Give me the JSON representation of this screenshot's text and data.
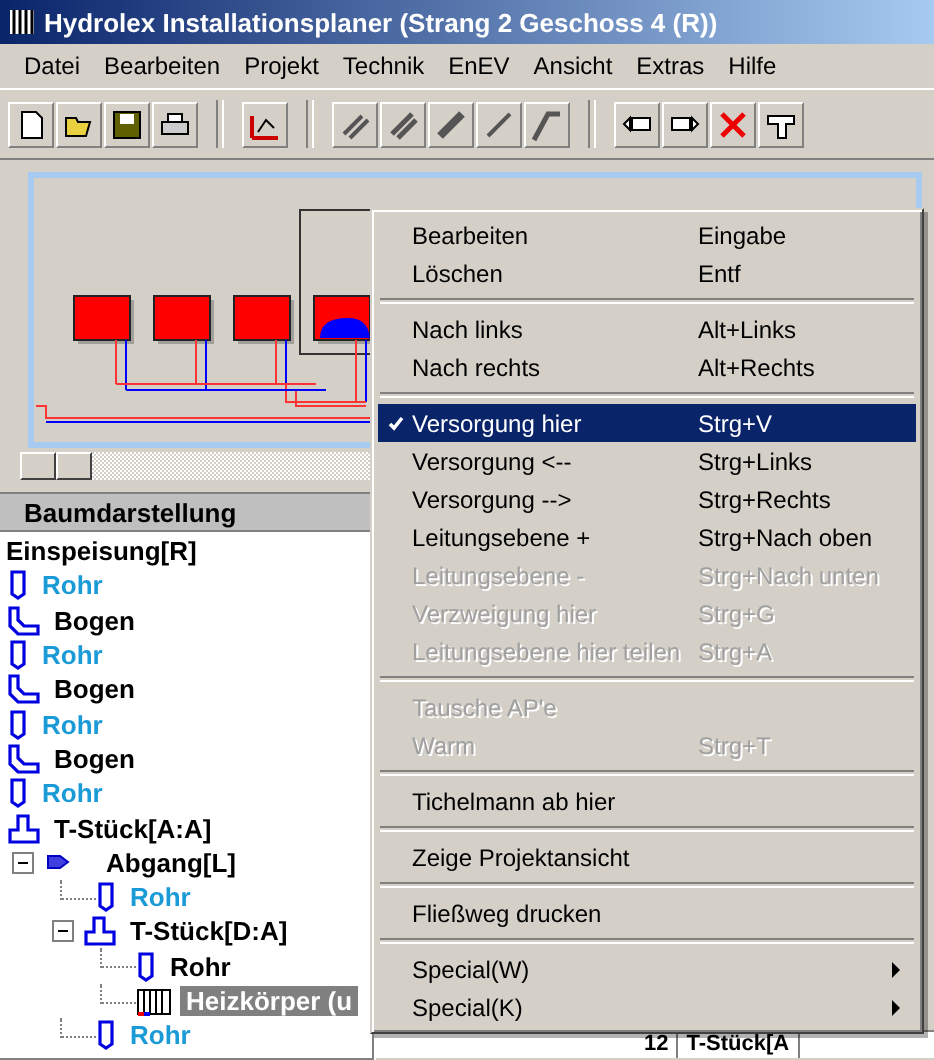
{
  "window": {
    "title": "Hydrolex Installationsplaner (Strang 2 Geschoss 4 (R))"
  },
  "menubar": [
    "Datei",
    "Bearbeiten",
    "Projekt",
    "Technik",
    "EnEV",
    "Ansicht",
    "Extras",
    "Hilfe"
  ],
  "tree_panel": {
    "title": "Baumdarstellung",
    "items": [
      {
        "label": "Einspeisung[R]",
        "kind": "feed",
        "color": "#000000",
        "selected": false
      },
      {
        "label": "Rohr",
        "kind": "pipe",
        "color": "#1a9ad6",
        "selected": false
      },
      {
        "label": "Bogen",
        "kind": "bend",
        "color": "#000000",
        "selected": false
      },
      {
        "label": "Rohr",
        "kind": "pipe",
        "color": "#1a9ad6",
        "selected": false
      },
      {
        "label": "Bogen",
        "kind": "bend",
        "color": "#000000",
        "selected": false
      },
      {
        "label": "Rohr",
        "kind": "pipe",
        "color": "#1a9ad6",
        "selected": false
      },
      {
        "label": "Bogen",
        "kind": "bend",
        "color": "#000000",
        "selected": false
      },
      {
        "label": "Rohr",
        "kind": "pipe",
        "color": "#1a9ad6",
        "selected": false
      },
      {
        "label": "T-Stück[A:A]",
        "kind": "tee",
        "color": "#000000",
        "selected": false,
        "children": [
          {
            "label": "Abgang[L]",
            "kind": "branch",
            "color": "#000000",
            "selected": false,
            "expanded": true,
            "children": [
              {
                "label": "Rohr",
                "kind": "pipe",
                "color": "#1a9ad6",
                "selected": false
              },
              {
                "label": "T-Stück[D:A]",
                "kind": "tee",
                "color": "#000000",
                "selected": false,
                "expanded": true,
                "children": [
                  {
                    "label": "Rohr",
                    "kind": "pipe",
                    "color": "#000000",
                    "selected": false
                  },
                  {
                    "label": "Heizkörper (u",
                    "kind": "radiator",
                    "selected": true
                  }
                ]
              },
              {
                "label": "Rohr",
                "kind": "pipe",
                "color": "#1a9ad6",
                "selected": false
              }
            ]
          }
        ]
      }
    ]
  },
  "detail_table": {
    "rows": [
      {
        "cells": [
          "12",
          "T-Stück[A"
        ]
      }
    ]
  },
  "context_menu": [
    {
      "kind": "item",
      "label": "Bearbeiten",
      "shortcut": "Eingabe",
      "disabled": false,
      "checked": false,
      "selected": false
    },
    {
      "kind": "item",
      "label": "Löschen",
      "shortcut": "Entf",
      "disabled": false,
      "checked": false,
      "selected": false
    },
    {
      "kind": "separator"
    },
    {
      "kind": "item",
      "label": "Nach links",
      "shortcut": "Alt+Links",
      "disabled": false,
      "checked": false,
      "selected": false
    },
    {
      "kind": "item",
      "label": "Nach rechts",
      "shortcut": "Alt+Rechts",
      "disabled": false,
      "checked": false,
      "selected": false
    },
    {
      "kind": "separator"
    },
    {
      "kind": "item",
      "label": "Versorgung hier",
      "shortcut": "Strg+V",
      "disabled": false,
      "checked": true,
      "selected": true
    },
    {
      "kind": "item",
      "label": "Versorgung <--",
      "shortcut": "Strg+Links",
      "disabled": false,
      "checked": false,
      "selected": false
    },
    {
      "kind": "item",
      "label": "Versorgung -->",
      "shortcut": "Strg+Rechts",
      "disabled": false,
      "checked": false,
      "selected": false
    },
    {
      "kind": "item",
      "label": "Leitungsebene +",
      "shortcut": "Strg+Nach oben",
      "disabled": false,
      "checked": false,
      "selected": false
    },
    {
      "kind": "item",
      "label": "Leitungsebene -",
      "shortcut": "Strg+Nach unten",
      "disabled": true,
      "checked": false,
      "selected": false
    },
    {
      "kind": "item",
      "label": "Verzweigung hier",
      "shortcut": "Strg+G",
      "disabled": true,
      "checked": false,
      "selected": false
    },
    {
      "kind": "item",
      "label": "Leitungsebene hier teilen",
      "shortcut": "Strg+A",
      "disabled": true,
      "checked": false,
      "selected": false
    },
    {
      "kind": "separator"
    },
    {
      "kind": "item",
      "label": "Tausche AP'e",
      "disabled": true,
      "checked": false,
      "selected": false
    },
    {
      "kind": "item",
      "label": "Warm",
      "shortcut": "Strg+T",
      "disabled": true,
      "checked": false,
      "selected": false
    },
    {
      "kind": "separator"
    },
    {
      "kind": "item",
      "label": "Tichelmann ab hier",
      "disabled": false,
      "checked": false,
      "selected": false
    },
    {
      "kind": "separator"
    },
    {
      "kind": "item",
      "label": "Zeige Projektansicht",
      "disabled": false,
      "checked": false,
      "selected": false
    },
    {
      "kind": "separator"
    },
    {
      "kind": "item",
      "label": "Fließweg drucken",
      "disabled": false,
      "checked": false,
      "selected": false
    },
    {
      "kind": "separator"
    },
    {
      "kind": "submenu",
      "label": "Special(W)",
      "disabled": false,
      "checked": false,
      "selected": false
    },
    {
      "kind": "submenu",
      "label": "Special(K)",
      "disabled": false,
      "checked": false,
      "selected": false
    }
  ]
}
